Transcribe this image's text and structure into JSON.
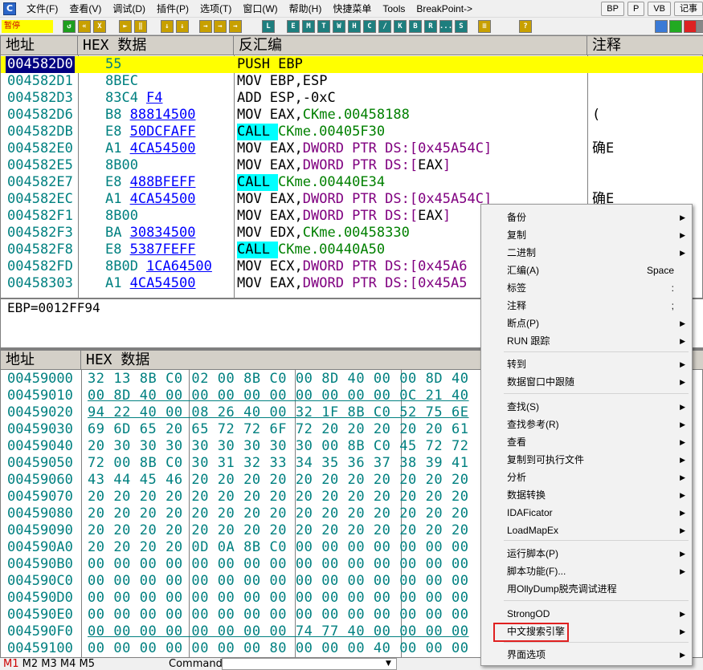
{
  "menu": {
    "app_icon": "C",
    "items": [
      "文件(F)",
      "查看(V)",
      "调试(D)",
      "插件(P)",
      "选项(T)",
      "窗口(W)",
      "帮助(H)",
      "快捷菜单",
      "Tools",
      "BreakPoint->"
    ],
    "right_buttons": [
      "BP",
      "P",
      "VB",
      "记事"
    ]
  },
  "toolbar": {
    "status": "暂停",
    "buttons": [
      "↺",
      "«",
      "X",
      "►",
      "‖",
      "↓",
      "↓",
      "→",
      "→",
      "→",
      "L",
      "E",
      "M",
      "T",
      "W",
      "H",
      "C",
      "/",
      "K",
      "B",
      "R",
      "...",
      "S",
      "≡",
      "?"
    ]
  },
  "cpu": {
    "headers": [
      "地址",
      "HEX 数据",
      "反汇编",
      "注释"
    ],
    "rows": [
      {
        "addr": "004582D0",
        "hex": "55",
        "dis": "PUSH EBP",
        "comment": ""
      },
      {
        "addr": "004582D1",
        "hex": "8BEC",
        "dis": "MOV EBP,ESP",
        "comment": ""
      },
      {
        "addr": "004582D3",
        "hex": "83C4 F4",
        "dis": "ADD ESP,-0xC",
        "comment": ""
      },
      {
        "addr": "004582D6",
        "hex": "B8 88814500",
        "dis": "MOV EAX,CKme.00458188",
        "comment": "("
      },
      {
        "addr": "004582DB",
        "hex": "E8 50DCFAFF",
        "dis": "CALL CKme.00405F30",
        "comment": ""
      },
      {
        "addr": "004582E0",
        "hex": "A1 4CA54500",
        "dis": "MOV EAX,DWORD PTR DS:[0x45A54C]",
        "comment": "确E"
      },
      {
        "addr": "004582E5",
        "hex": "8B00",
        "dis": "MOV EAX,DWORD PTR DS:[EAX]",
        "comment": ""
      },
      {
        "addr": "004582E7",
        "hex": "E8 488BFEFF",
        "dis": "CALL CKme.00440E34",
        "comment": ""
      },
      {
        "addr": "004582EC",
        "hex": "A1 4CA54500",
        "dis": "MOV EAX,DWORD PTR DS:[0x45A54C]",
        "comment": "确E"
      },
      {
        "addr": "004582F1",
        "hex": "8B00",
        "dis": "MOV EAX,DWORD PTR DS:[EAX]",
        "comment": ""
      },
      {
        "addr": "004582F3",
        "hex": "BA 30834500",
        "dis": "MOV EDX,CKme.00458330",
        "comment": ""
      },
      {
        "addr": "004582F8",
        "hex": "E8 5387FEFF",
        "dis": "CALL CKme.00440A50",
        "comment": ""
      },
      {
        "addr": "004582FD",
        "hex": "8B0D 1CA64500",
        "dis": "MOV ECX,DWORD PTR DS:[0x45A6",
        "comment": ""
      },
      {
        "addr": "00458303",
        "hex": "A1 4CA54500",
        "dis": "MOV EAX,DWORD PTR DS:[0x45A5",
        "comment": ""
      }
    ]
  },
  "info": {
    "text": "EBP=0012FF94"
  },
  "dump": {
    "headers": [
      "地址",
      "HEX 数据"
    ],
    "rows": [
      {
        "addr": "00459000",
        "hex": "32 13 8B C0 02 00 8B C0 00 8D 40 00 00 8D 40"
      },
      {
        "addr": "00459010",
        "hex": "00 8D 40 00 00 00 00 00 00 00 00 00 0C 21 40"
      },
      {
        "addr": "00459020",
        "hex": "94 22 40 00 08 26 40 00 32 1F 8B C0 52 75 6E"
      },
      {
        "addr": "00459030",
        "hex": "69 6D 65 20 65 72 72 6F 72 20 20 20 20 20 61"
      },
      {
        "addr": "00459040",
        "hex": "20 30 30 30 30 30 30 30 30 00 8B C0 45 72 72"
      },
      {
        "addr": "00459050",
        "hex": "72 00 8B C0 30 31 32 33 34 35 36 37 38 39 41"
      },
      {
        "addr": "00459060",
        "hex": "43 44 45 46 20 20 20 20 20 20 20 20 20 20 20"
      },
      {
        "addr": "00459070",
        "hex": "20 20 20 20 20 20 20 20 20 20 20 20 20 20 20"
      },
      {
        "addr": "00459080",
        "hex": "20 20 20 20 20 20 20 20 20 20 20 20 20 20 20"
      },
      {
        "addr": "00459090",
        "hex": "20 20 20 20 20 20 20 20 20 20 20 20 20 20 20"
      },
      {
        "addr": "004590A0",
        "hex": "20 20 20 20 0D 0A 8B C0 00 00 00 00 00 00 00"
      },
      {
        "addr": "004590B0",
        "hex": "00 00 00 00 00 00 00 00 00 00 00 00 00 00 00"
      },
      {
        "addr": "004590C0",
        "hex": "00 00 00 00 00 00 00 00 00 00 00 00 00 00 00"
      },
      {
        "addr": "004590D0",
        "hex": "00 00 00 00 00 00 00 00 00 00 00 00 00 00 00"
      },
      {
        "addr": "004590E0",
        "hex": "00 00 00 00 00 00 00 00 00 00 00 00 00 00 00"
      },
      {
        "addr": "004590F0",
        "hex": "00 00 00 00 00 00 00 00 74 77 40 00 00 00 00"
      },
      {
        "addr": "00459100",
        "hex": "00 00 00 00 00 00 00 80 00 00 00 40 00 00 00"
      }
    ]
  },
  "bottom": {
    "markers": "M1 M2 M3 M4 M5",
    "command_label": "Command:"
  },
  "context_menu": {
    "items": [
      {
        "label": "备份",
        "sub": true
      },
      {
        "label": "复制",
        "sub": true
      },
      {
        "label": "二进制",
        "sub": true
      },
      {
        "label": "汇编(A)",
        "shortcut": "Space"
      },
      {
        "label": "标签",
        "shortcut": ":"
      },
      {
        "label": "注释",
        "shortcut": ";"
      },
      {
        "label": "断点(P)",
        "sub": true
      },
      {
        "label": "RUN 跟踪",
        "sub": true
      },
      {
        "label": "转到",
        "sub": true
      },
      {
        "label": "数据窗口中跟随",
        "sub": true
      },
      {
        "label": "查找(S)",
        "sub": true
      },
      {
        "label": "查找参考(R)",
        "sub": true
      },
      {
        "label": "查看",
        "sub": true
      },
      {
        "label": "复制到可执行文件",
        "sub": true
      },
      {
        "label": "分析",
        "sub": true
      },
      {
        "label": "数据转换",
        "sub": true
      },
      {
        "label": "IDAFicator",
        "sub": true
      },
      {
        "label": "LoadMapEx",
        "sub": true
      },
      {
        "label": "运行脚本(P)",
        "sub": true
      },
      {
        "label": "脚本功能(F)...",
        "sub": true
      },
      {
        "label": "用OllyDump脱壳调试进程"
      },
      {
        "label": "StrongOD",
        "sub": true
      },
      {
        "label": "中文搜索引擎",
        "sub": true
      },
      {
        "label": "界面选项",
        "sub": true
      }
    ]
  },
  "colors": {
    "selected_row": "#ffff00",
    "call_highlight": "#00ffff",
    "highlight_box": "#e02020"
  }
}
